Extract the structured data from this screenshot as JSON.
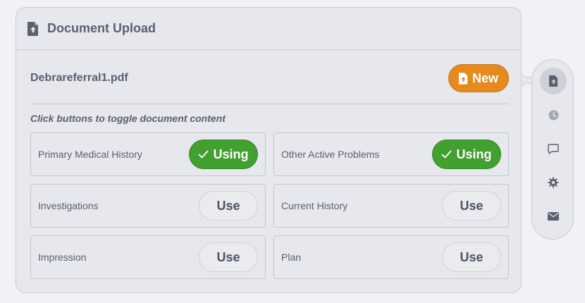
{
  "panel": {
    "title": "Document Upload",
    "header_icon": "file-upload-icon"
  },
  "file": {
    "name": "Debrareferral1.pdf",
    "new_label": "New",
    "new_icon": "file-upload-icon"
  },
  "hint": "Click buttons to toggle document content",
  "sections": [
    {
      "label": "Primary Medical History",
      "button": "Using",
      "active": true
    },
    {
      "label": "Other Active Problems",
      "button": "Using",
      "active": true
    },
    {
      "label": "Investigations",
      "button": "Use",
      "active": false
    },
    {
      "label": "Current History",
      "button": "Use",
      "active": false
    },
    {
      "label": "Impression",
      "button": "Use",
      "active": false
    },
    {
      "label": "Plan",
      "button": "Use",
      "active": false
    }
  ],
  "sidebar": {
    "items": [
      {
        "icon": "file-upload-icon",
        "active": true
      },
      {
        "icon": "clock-icon",
        "active": false
      },
      {
        "icon": "chat-icon",
        "active": false
      },
      {
        "icon": "gear-icon",
        "active": false
      },
      {
        "icon": "envelope-icon",
        "active": false
      }
    ]
  },
  "colors": {
    "accent_orange": "#e68a1e",
    "active_green": "#41a02f",
    "text": "#5b6070"
  }
}
